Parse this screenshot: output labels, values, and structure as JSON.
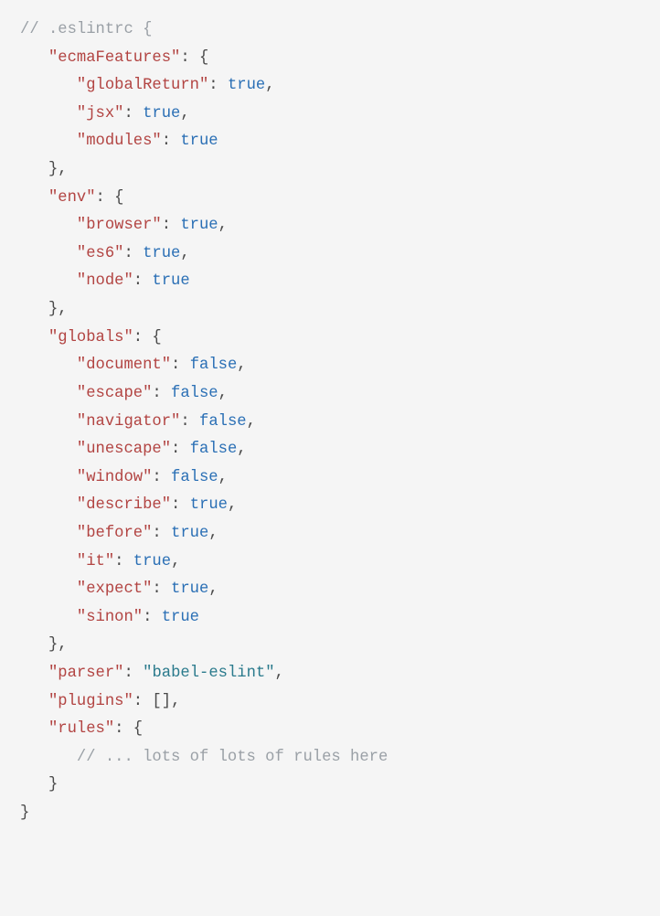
{
  "file_label": ".eslintrc",
  "config": {
    "ecmaFeatures": {
      "globalReturn": true,
      "jsx": true,
      "modules": true
    },
    "env": {
      "browser": true,
      "es6": true,
      "node": true
    },
    "globals": {
      "document": false,
      "escape": false,
      "navigator": false,
      "unescape": false,
      "window": false,
      "describe": true,
      "before": true,
      "it": true,
      "expect": true,
      "sinon": true
    },
    "parser": "babel-eslint",
    "plugins_literal": "[]",
    "rules_comment": "... lots of lots of rules here"
  },
  "tokens": [
    {
      "indent": 0,
      "parts": [
        {
          "cls": "c",
          "t": "// "
        },
        {
          "cls": "c",
          "bind": "file_label"
        },
        {
          "cls": "c",
          "t": " {"
        }
      ]
    },
    {
      "indent": 1,
      "parts": [
        {
          "cls": "k",
          "t": "\"ecmaFeatures\""
        },
        {
          "cls": "p",
          "t": ": {"
        }
      ]
    },
    {
      "indent": 2,
      "parts": [
        {
          "cls": "k",
          "t": "\"globalReturn\""
        },
        {
          "cls": "p",
          "t": ": "
        },
        {
          "cls": "b",
          "bind": "config.ecmaFeatures.globalReturn"
        },
        {
          "cls": "p",
          "t": ","
        }
      ]
    },
    {
      "indent": 2,
      "parts": [
        {
          "cls": "k",
          "t": "\"jsx\""
        },
        {
          "cls": "p",
          "t": ": "
        },
        {
          "cls": "b",
          "bind": "config.ecmaFeatures.jsx"
        },
        {
          "cls": "p",
          "t": ","
        }
      ]
    },
    {
      "indent": 2,
      "parts": [
        {
          "cls": "k",
          "t": "\"modules\""
        },
        {
          "cls": "p",
          "t": ": "
        },
        {
          "cls": "b",
          "bind": "config.ecmaFeatures.modules"
        }
      ]
    },
    {
      "indent": 1,
      "parts": [
        {
          "cls": "p",
          "t": "},"
        }
      ]
    },
    {
      "indent": 1,
      "parts": [
        {
          "cls": "k",
          "t": "\"env\""
        },
        {
          "cls": "p",
          "t": ": {"
        }
      ]
    },
    {
      "indent": 2,
      "parts": [
        {
          "cls": "k",
          "t": "\"browser\""
        },
        {
          "cls": "p",
          "t": ": "
        },
        {
          "cls": "b",
          "bind": "config.env.browser"
        },
        {
          "cls": "p",
          "t": ","
        }
      ]
    },
    {
      "indent": 2,
      "parts": [
        {
          "cls": "k",
          "t": "\"es6\""
        },
        {
          "cls": "p",
          "t": ": "
        },
        {
          "cls": "b",
          "bind": "config.env.es6"
        },
        {
          "cls": "p",
          "t": ","
        }
      ]
    },
    {
      "indent": 2,
      "parts": [
        {
          "cls": "k",
          "t": "\"node\""
        },
        {
          "cls": "p",
          "t": ": "
        },
        {
          "cls": "b",
          "bind": "config.env.node"
        }
      ]
    },
    {
      "indent": 1,
      "parts": [
        {
          "cls": "p",
          "t": "},"
        }
      ]
    },
    {
      "indent": 1,
      "parts": [
        {
          "cls": "k",
          "t": "\"globals\""
        },
        {
          "cls": "p",
          "t": ": {"
        }
      ]
    },
    {
      "indent": 2,
      "parts": [
        {
          "cls": "k",
          "t": "\"document\""
        },
        {
          "cls": "p",
          "t": ": "
        },
        {
          "cls": "b",
          "bind": "config.globals.document"
        },
        {
          "cls": "p",
          "t": ","
        }
      ]
    },
    {
      "indent": 2,
      "parts": [
        {
          "cls": "k",
          "t": "\"escape\""
        },
        {
          "cls": "p",
          "t": ": "
        },
        {
          "cls": "b",
          "bind": "config.globals.escape"
        },
        {
          "cls": "p",
          "t": ","
        }
      ]
    },
    {
      "indent": 2,
      "parts": [
        {
          "cls": "k",
          "t": "\"navigator\""
        },
        {
          "cls": "p",
          "t": ": "
        },
        {
          "cls": "b",
          "bind": "config.globals.navigator"
        },
        {
          "cls": "p",
          "t": ","
        }
      ]
    },
    {
      "indent": 2,
      "parts": [
        {
          "cls": "k",
          "t": "\"unescape\""
        },
        {
          "cls": "p",
          "t": ": "
        },
        {
          "cls": "b",
          "bind": "config.globals.unescape"
        },
        {
          "cls": "p",
          "t": ","
        }
      ]
    },
    {
      "indent": 2,
      "parts": [
        {
          "cls": "k",
          "t": "\"window\""
        },
        {
          "cls": "p",
          "t": ": "
        },
        {
          "cls": "b",
          "bind": "config.globals.window"
        },
        {
          "cls": "p",
          "t": ","
        }
      ]
    },
    {
      "indent": 2,
      "parts": [
        {
          "cls": "k",
          "t": "\"describe\""
        },
        {
          "cls": "p",
          "t": ": "
        },
        {
          "cls": "b",
          "bind": "config.globals.describe"
        },
        {
          "cls": "p",
          "t": ","
        }
      ]
    },
    {
      "indent": 2,
      "parts": [
        {
          "cls": "k",
          "t": "\"before\""
        },
        {
          "cls": "p",
          "t": ": "
        },
        {
          "cls": "b",
          "bind": "config.globals.before"
        },
        {
          "cls": "p",
          "t": ","
        }
      ]
    },
    {
      "indent": 2,
      "parts": [
        {
          "cls": "k",
          "t": "\"it\""
        },
        {
          "cls": "p",
          "t": ": "
        },
        {
          "cls": "b",
          "bind": "config.globals.it"
        },
        {
          "cls": "p",
          "t": ","
        }
      ]
    },
    {
      "indent": 2,
      "parts": [
        {
          "cls": "k",
          "t": "\"expect\""
        },
        {
          "cls": "p",
          "t": ": "
        },
        {
          "cls": "b",
          "bind": "config.globals.expect"
        },
        {
          "cls": "p",
          "t": ","
        }
      ]
    },
    {
      "indent": 2,
      "parts": [
        {
          "cls": "k",
          "t": "\"sinon\""
        },
        {
          "cls": "p",
          "t": ": "
        },
        {
          "cls": "b",
          "bind": "config.globals.sinon"
        }
      ]
    },
    {
      "indent": 1,
      "parts": [
        {
          "cls": "p",
          "t": "},"
        }
      ]
    },
    {
      "indent": 1,
      "parts": [
        {
          "cls": "k",
          "t": "\"parser\""
        },
        {
          "cls": "p",
          "t": ": "
        },
        {
          "cls": "s",
          "t": "\""
        },
        {
          "cls": "s",
          "bind": "config.parser"
        },
        {
          "cls": "s",
          "t": "\""
        },
        {
          "cls": "p",
          "t": ","
        }
      ]
    },
    {
      "indent": 1,
      "parts": [
        {
          "cls": "k",
          "t": "\"plugins\""
        },
        {
          "cls": "p",
          "t": ": "
        },
        {
          "cls": "p",
          "bind": "config.plugins_literal"
        },
        {
          "cls": "p",
          "t": ","
        }
      ]
    },
    {
      "indent": 1,
      "parts": [
        {
          "cls": "k",
          "t": "\"rules\""
        },
        {
          "cls": "p",
          "t": ": {"
        }
      ]
    },
    {
      "indent": 2,
      "parts": [
        {
          "cls": "c",
          "t": "// "
        },
        {
          "cls": "c",
          "bind": "config.rules_comment"
        }
      ]
    },
    {
      "indent": 1,
      "parts": [
        {
          "cls": "p",
          "t": "}"
        }
      ]
    },
    {
      "indent": 0,
      "parts": [
        {
          "cls": "p",
          "t": "}"
        }
      ]
    }
  ]
}
